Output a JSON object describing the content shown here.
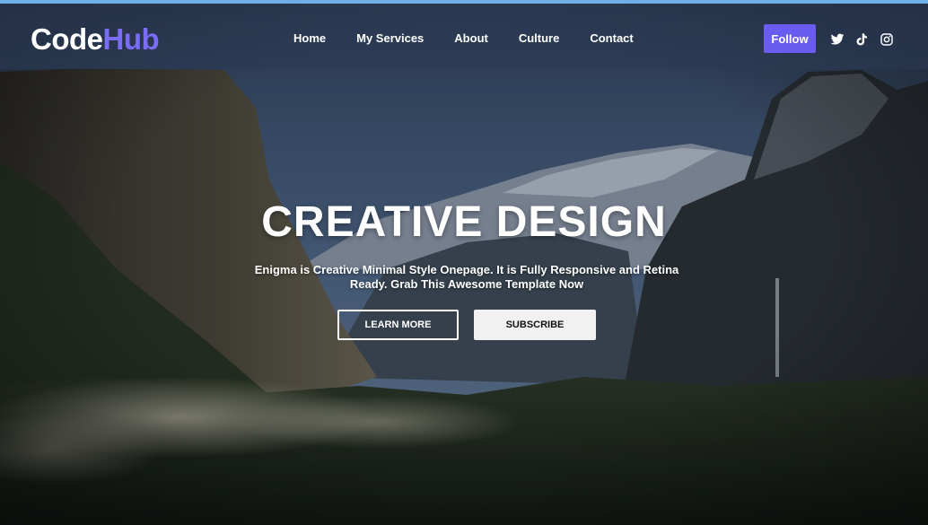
{
  "brand": {
    "part1": "Code",
    "part2": "Hub",
    "part1_color": "#ffffff",
    "part2_color": "#7a6cf5"
  },
  "nav": {
    "links": [
      {
        "label": "Home"
      },
      {
        "label": "My Services"
      },
      {
        "label": "About"
      },
      {
        "label": "Culture"
      },
      {
        "label": "Contact"
      }
    ],
    "follow_label": "Follow",
    "follow_color": "#6a5cf0",
    "social_icons": [
      "twitter-icon",
      "tiktok-icon",
      "instagram-icon"
    ]
  },
  "hero": {
    "title": "CREATIVE DESIGN",
    "subtitle": "Enigma is Creative Minimal Style Onepage. It is Fully Responsive and Retina Ready. Grab This Awesome Template Now",
    "learn_more_label": "LEARN MORE",
    "subscribe_label": "SUBSCRIBE",
    "background_image": "mountain-valley-landscape"
  }
}
